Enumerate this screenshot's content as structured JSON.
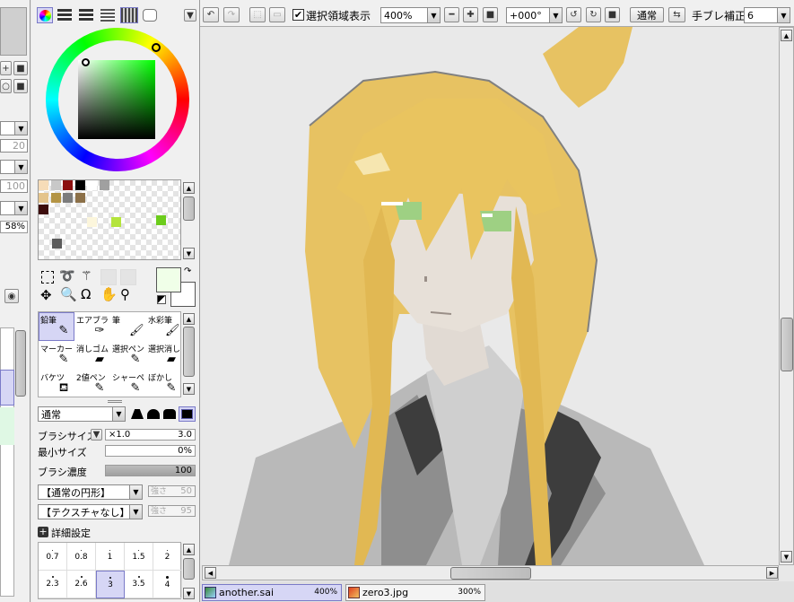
{
  "toolbar": {
    "show_selection_label": "選択領域表示",
    "zoom_value": "400%",
    "rotation_value": "+000°",
    "blend_mode": "通常",
    "stabilizer_label": "手ブレ補正",
    "stabilizer_value": "6"
  },
  "brush": {
    "mode": "通常",
    "size_label": "ブラシサイズ",
    "size_multiplier": "×1.0",
    "size_value": "3.0",
    "min_size_label": "最小サイズ",
    "min_size_value": "0%",
    "density_label": "ブラシ濃度",
    "density_value": "100",
    "density_fraction": 1.0,
    "shape_select": "【通常の円形】",
    "shape_strength_label": "強さ",
    "shape_strength_value": "50",
    "texture_select": "【テクスチャなし】",
    "texture_strength_label": "強さ",
    "texture_strength_value": "95",
    "advanced_label": "詳細設定",
    "sizes_row1": [
      "0.7",
      "0.8",
      "1",
      "1.5",
      "2"
    ],
    "sizes_row2": [
      "2.3",
      "2.6",
      "3",
      "3.5",
      "4"
    ]
  },
  "tools": [
    {
      "label": "鉛筆",
      "icon": "pencil-icon",
      "glyph": "✎"
    },
    {
      "label": "エアブラシ",
      "icon": "airbrush-icon",
      "glyph": "✑"
    },
    {
      "label": "筆",
      "icon": "brush-icon",
      "glyph": "🖌"
    },
    {
      "label": "水彩筆",
      "icon": "watercolor-brush-icon",
      "glyph": "🖌"
    },
    {
      "label": "マーカー",
      "icon": "marker-icon",
      "glyph": "✎"
    },
    {
      "label": "消しゴム",
      "icon": "eraser-icon",
      "glyph": "▰"
    },
    {
      "label": "選択ペン",
      "icon": "selection-pen-icon",
      "glyph": "✎"
    },
    {
      "label": "選択消し",
      "icon": "selection-eraser-icon",
      "glyph": "▰"
    },
    {
      "label": "バケツ",
      "icon": "bucket-icon",
      "glyph": "⛾"
    },
    {
      "label": "2値ペン",
      "icon": "binary-pen-icon",
      "glyph": "✎"
    },
    {
      "label": "シャーペン",
      "icon": "mechanical-pencil-icon",
      "glyph": "✎"
    },
    {
      "label": "ぼかし",
      "icon": "blur-icon",
      "glyph": "✎"
    }
  ],
  "left_strip": {
    "value_20": "20",
    "value_100": "100",
    "opacity_value": "58%"
  },
  "tabs": [
    {
      "name": "another.sai",
      "zoom": "400%"
    },
    {
      "name": "zero3.jpg",
      "zoom": "300%"
    }
  ],
  "colors": {
    "selection": "#d6d6f5",
    "canvas_bg": "#e9e9e9",
    "foreground": "#f0ffe8",
    "background": "#ffffff"
  },
  "palette": [
    "#f6dcb8",
    "#c8c8c8",
    "#8c1010",
    "#000000",
    "#ffffff",
    "#a0a0a0",
    "",
    "#e4c48c",
    "#b49444",
    "#7c7c7c",
    "#8c7048",
    "",
    "",
    "",
    "#3c0c0c",
    "",
    "",
    "",
    "",
    "",
    "",
    "",
    "",
    "",
    "",
    "#fcf6dc",
    "",
    "#b4e43c"
  ]
}
